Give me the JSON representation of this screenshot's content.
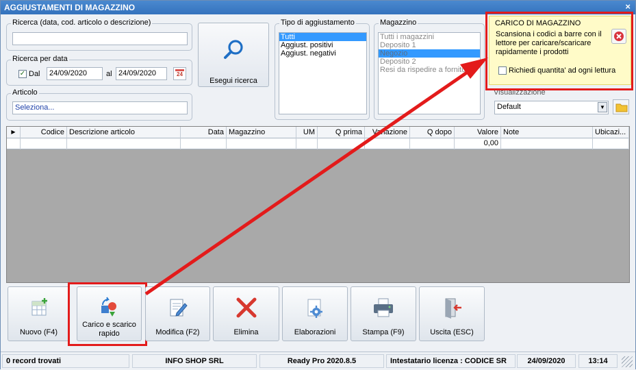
{
  "window": {
    "title": "AGGIUSTAMENTI DI MAGAZZINO",
    "close": "×"
  },
  "search": {
    "legend": "Ricerca (data, cod. articolo o descrizione)",
    "value": ""
  },
  "date_search": {
    "legend": "Ricerca per data",
    "check_mark": "✓",
    "from_label": "Dal",
    "from_value": "24/09/2020",
    "to_label": "al",
    "to_value": "24/09/2020",
    "calendar_day": "24"
  },
  "article": {
    "legend": "Articolo",
    "value": "Seleziona..."
  },
  "search_button": {
    "label": "Esegui ricerca"
  },
  "adjustment_type": {
    "legend": "Tipo di aggiustamento",
    "items": [
      "Tutti",
      "Aggiust. positivi",
      "Aggiust. negativi"
    ],
    "selected_index": 0
  },
  "warehouse": {
    "legend": "Magazzino",
    "items": [
      "Tutti i magazzini",
      "Deposito 1",
      "Negozio",
      "Deposito 2",
      "Resi da rispedire a fornitori"
    ],
    "selected_index": 2
  },
  "tooltip": {
    "title": "CARICO DI MAGAZZINO",
    "text": "Scansiona i codici a barre con il lettore per caricare/scaricare rapidamente i prodotti",
    "checkbox_label": "Richiedi quantita' ad ogni lettura"
  },
  "view": {
    "legend": "Visualizzazione",
    "value": "Default"
  },
  "grid": {
    "columns": [
      "Codice",
      "Descrizione articolo",
      "Data",
      "Magazzino",
      "UM",
      "Q prima",
      "Variazione",
      "Q dopo",
      "Valore",
      "Note",
      "Ubicazi..."
    ],
    "row": {
      "Valore": "0,00"
    }
  },
  "buttons": {
    "new": "Nuovo (F4)",
    "quick_load": "Carico e scarico rapido",
    "edit": "Modifica (F2)",
    "delete": "Elimina",
    "process": "Elaborazioni",
    "print": "Stampa (F9)",
    "exit": "Uscita (ESC)"
  },
  "status": {
    "records": "0 record trovati",
    "company": "INFO SHOP SRL",
    "version": "Ready Pro 2020.8.5",
    "license": "Intestatario licenza : CODICE SR",
    "date": "24/09/2020",
    "time": "13:14"
  },
  "colors": {
    "accent": "#3472bd",
    "highlight": "#e31b1b",
    "tooltip_bg": "#fffbc8"
  }
}
